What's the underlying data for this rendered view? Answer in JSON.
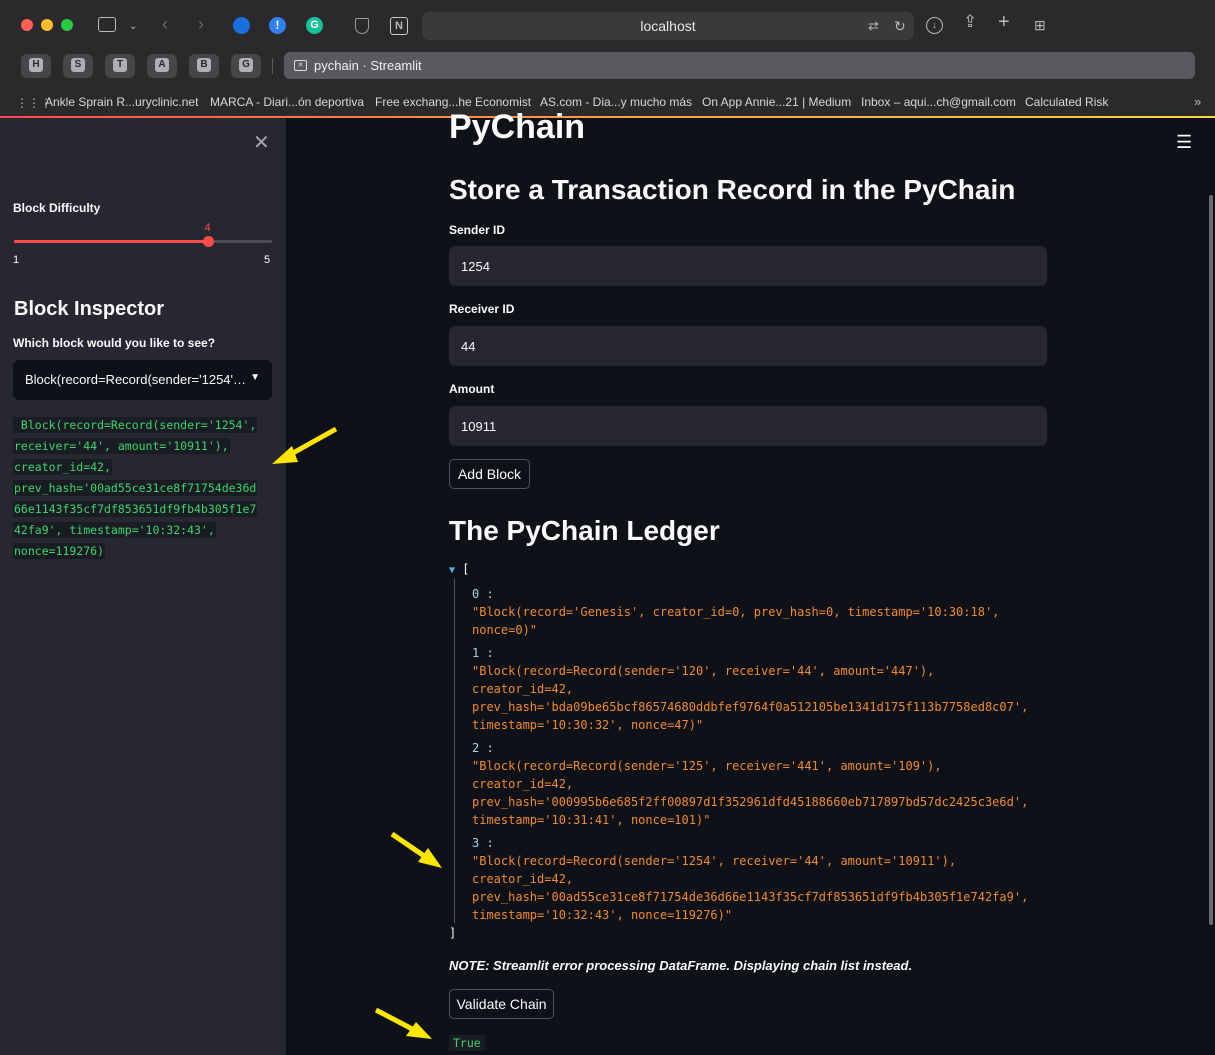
{
  "browser": {
    "url": "localhost",
    "favicons": [
      "H",
      "S",
      "T",
      "A",
      "B",
      "G"
    ],
    "tab_title": "pychain · Streamlit",
    "bookmarks": [
      "Ankle Sprain R...uryclinic.net",
      "MARCA - Diari...ón deportiva",
      "Free exchang...he Economist",
      "AS.com - Dia...y mucho más",
      "On App Annie...21 | Medium",
      "Inbox – aqui...ch@gmail.com",
      "Calculated Risk"
    ]
  },
  "sidebar": {
    "slider_label": "Block Difficulty",
    "slider_value": "4",
    "slider_fraction": 0.75,
    "slider_min": "1",
    "slider_max": "5",
    "inspector_title": "Block Inspector",
    "select_label": "Which block would you like to see?",
    "select_value": "Block(record=Record(sender='1254', receiver='44', amount='10911'), creator_id=42, prev_hash='00ad55ce31ce8f71754de36d66e1143f35cf7df853651df9fb4b305f1e742fa9', timestamp='10:32:43', nonce=119276)",
    "block_lines": [
      " Block(record=Record(sender='1254',",
      "receiver='44', amount='10911'),",
      "creator_id=42,",
      "prev_hash='00ad55ce31ce8f71754de36d",
      "66e1143f35cf7df853651df9fb4b305f1e7",
      "42fa9', timestamp='10:32:43',",
      "nonce=119276)"
    ]
  },
  "main": {
    "app_title": "PyChain",
    "form_title": "Store a Transaction Record in the PyChain",
    "sender_label": "Sender ID",
    "sender_value": "1254",
    "receiver_label": "Receiver ID",
    "receiver_value": "44",
    "amount_label": "Amount",
    "amount_value": "10911",
    "add_button": "Add Block",
    "ledger_title": "The PyChain Ledger",
    "ledger_open": "[",
    "ledger_close": "]",
    "ledger": [
      {
        "index": "0 :",
        "lines": [
          "\"Block(record='Genesis', creator_id=0, prev_hash=0, timestamp='10:30:18',",
          "nonce=0)\""
        ]
      },
      {
        "index": "1 :",
        "lines": [
          "\"Block(record=Record(sender='120', receiver='44', amount='447'),",
          "creator_id=42,",
          "prev_hash='bda09be65bcf86574680ddbfef9764f0a512105be1341d175f113b7758ed8c07',",
          "timestamp='10:30:32', nonce=47)\""
        ]
      },
      {
        "index": "2 :",
        "lines": [
          "\"Block(record=Record(sender='125', receiver='441', amount='109'),",
          "creator_id=42,",
          "prev_hash='000995b6e685f2ff00897d1f352961dfd45188660eb717897bd57dc2425c3e6d',",
          "timestamp='10:31:41', nonce=101)\""
        ]
      },
      {
        "index": "3 :",
        "lines": [
          "\"Block(record=Record(sender='1254', receiver='44', amount='10911'),",
          "creator_id=42,",
          "prev_hash='00ad55ce31ce8f71754de36d66e1143f35cf7df853651df9fb4b305f1e742fa9',",
          "timestamp='10:32:43', nonce=119276)\""
        ]
      }
    ],
    "note": "NOTE: Streamlit error processing DataFrame. Displaying chain list instead.",
    "validate_button": "Validate Chain",
    "validate_result": "True"
  }
}
